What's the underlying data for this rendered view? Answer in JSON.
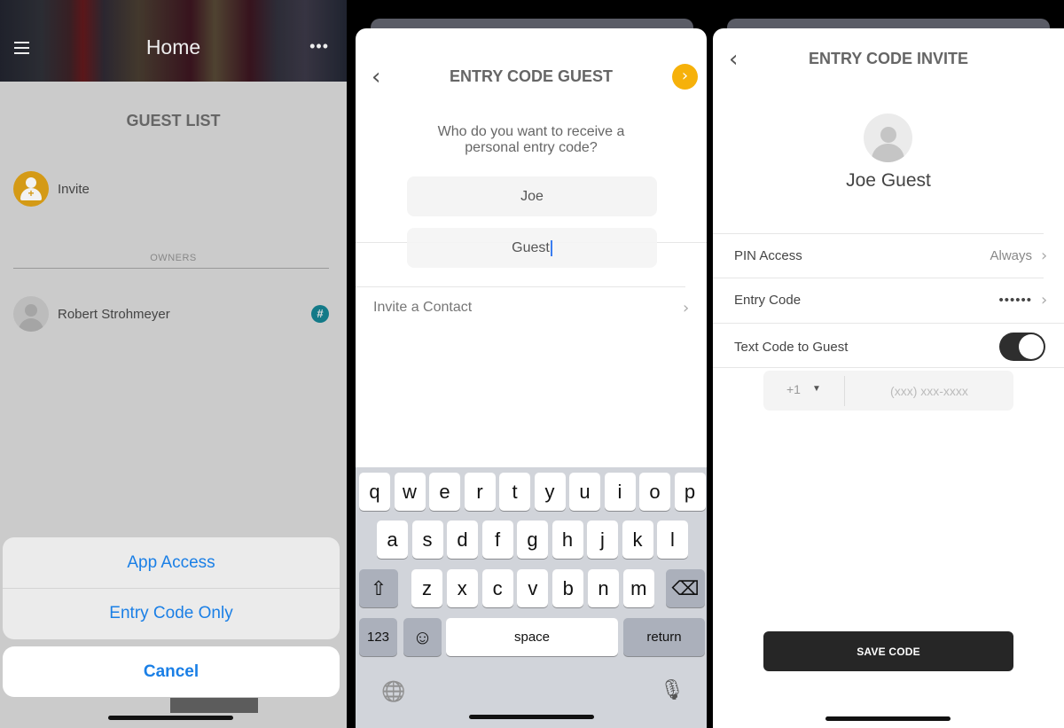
{
  "panel1": {
    "header": {
      "title": "Home",
      "menu_icon": "hamburger-icon",
      "more_icon": "more-dots-icon",
      "more_glyph": "•••"
    },
    "section_title": "GUEST LIST",
    "invite": {
      "label": "Invite",
      "icon": "add-user-icon",
      "color": "#d49a16"
    },
    "owners_label": "OWNERS",
    "owners": [
      {
        "name": "Robert Strohmeyer",
        "badge": "#",
        "badge_color": "#137a88"
      }
    ],
    "action_sheet": {
      "options": [
        "App Access",
        "Entry Code Only"
      ],
      "cancel": "Cancel",
      "accent": "#1a7fe6"
    }
  },
  "panel2": {
    "title": "ENTRY CODE GUEST",
    "next_glyph": "›",
    "back_glyph": "‹",
    "prompt_line1": "Who do you want to receive a",
    "prompt_line2": "personal entry code?",
    "first_name": "Joe",
    "last_name": "Guest",
    "invite_contact": "Invite a Contact",
    "accent": "#f6b10a",
    "keyboard": {
      "row1": [
        "q",
        "w",
        "e",
        "r",
        "t",
        "y",
        "u",
        "i",
        "o",
        "p"
      ],
      "row2": [
        "a",
        "s",
        "d",
        "f",
        "g",
        "h",
        "j",
        "k",
        "l"
      ],
      "row3": [
        "z",
        "x",
        "c",
        "v",
        "b",
        "n",
        "m"
      ],
      "shift": "⇧",
      "backspace": "⌫",
      "numbers": "123",
      "emoji": "☺",
      "space": "space",
      "return": "return",
      "globe": "🌐",
      "mic": "🎙"
    }
  },
  "panel3": {
    "title": "ENTRY CODE INVITE",
    "back_glyph": "‹",
    "guest_name": "Joe Guest",
    "rows": [
      {
        "label": "PIN Access",
        "value": "Always"
      },
      {
        "label": "Entry Code",
        "value": "••••••"
      }
    ],
    "text_code": {
      "label": "Text Code to Guest",
      "enabled": true
    },
    "phone": {
      "country_code": "+1",
      "arrow": "▼",
      "placeholder": "(xxx) xxx-xxxx",
      "value": ""
    },
    "save_label": "SAVE CODE"
  }
}
